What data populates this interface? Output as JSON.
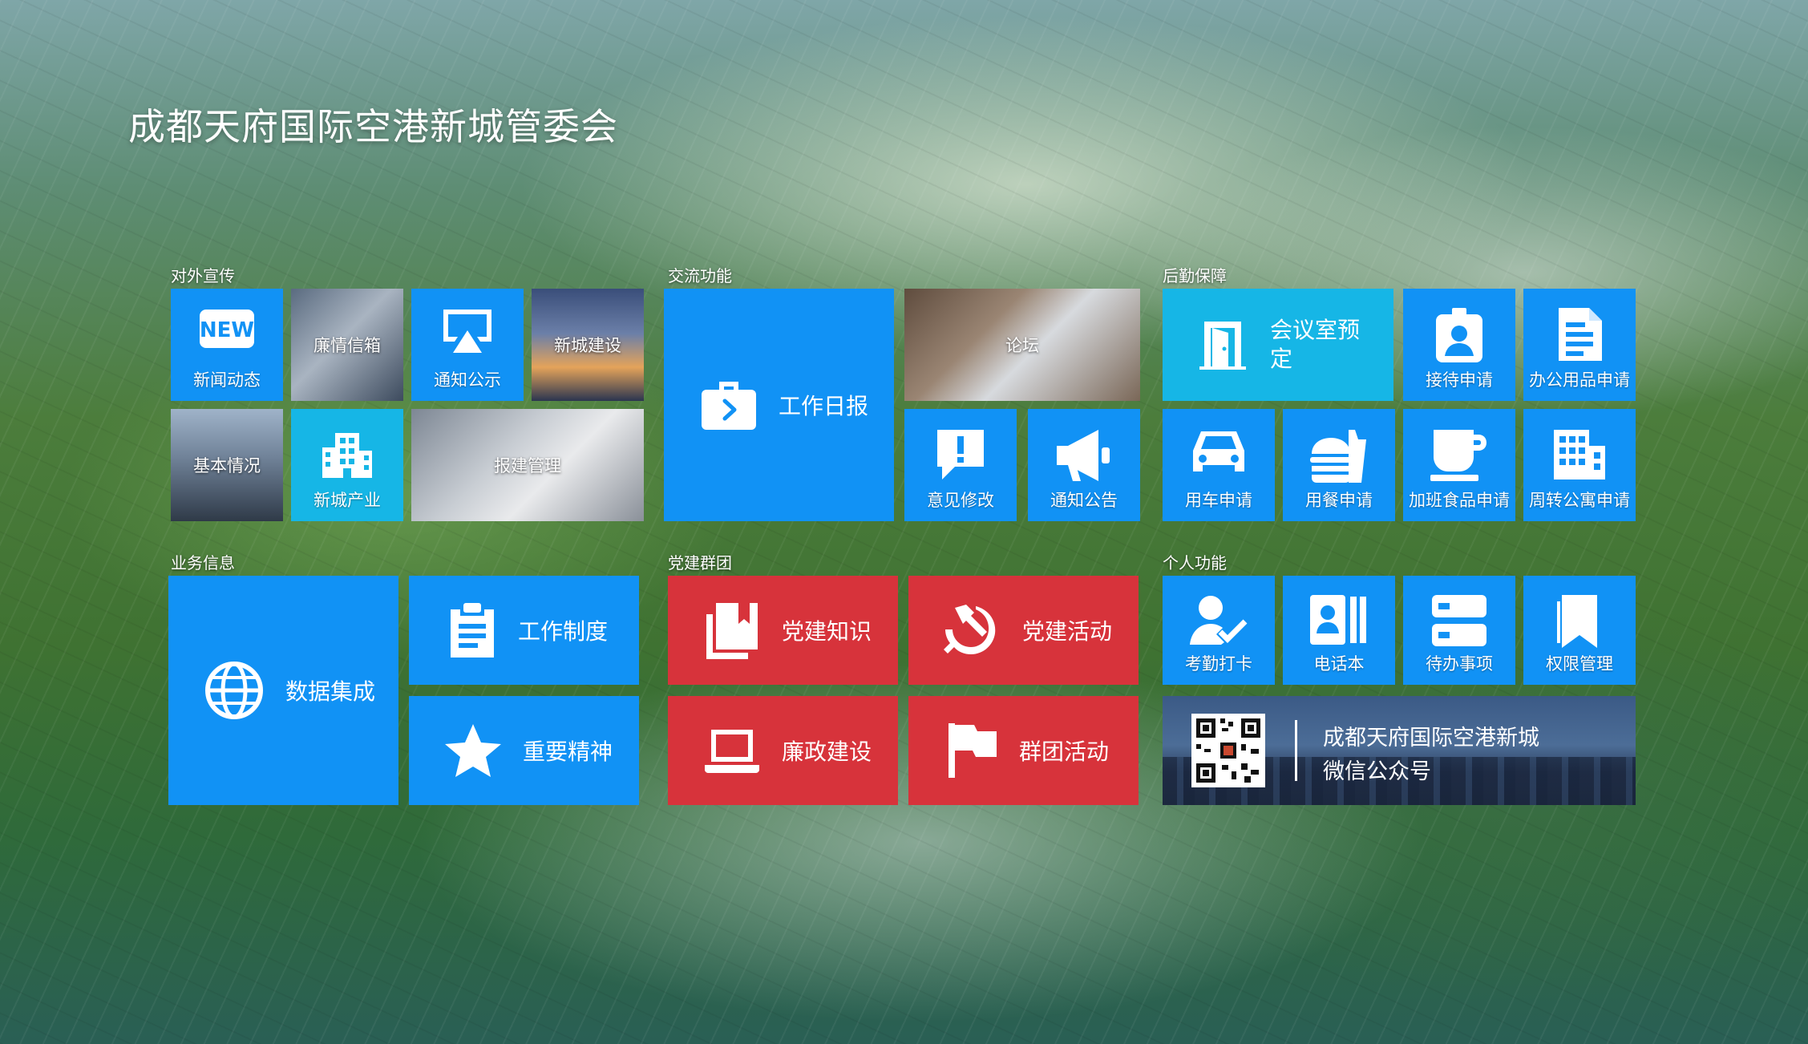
{
  "page": {
    "title": "成都天府国际空港新城管委会"
  },
  "sections": {
    "external": "对外宣传",
    "exchange": "交流功能",
    "logistics": "后勤保障",
    "business": "业务信息",
    "party": "党建群团",
    "personal": "个人功能"
  },
  "external_tiles": {
    "news": "新闻动态",
    "mailbox": "廉情信箱",
    "notice": "通知公示",
    "construction": "新城建设",
    "basic": "基本情况",
    "industry": "新城产业",
    "report_mgmt": "报建管理"
  },
  "exchange_tiles": {
    "daily_report": "工作日报",
    "forum": "论坛",
    "feedback": "意见修改",
    "announcement": "通知公告"
  },
  "logistics_tiles": {
    "meeting_room": "会议室预定",
    "reception": "接待申请",
    "office_supplies": "办公用品申请",
    "vehicle": "用车申请",
    "meal": "用餐申请",
    "overtime_food": "加班食品申请",
    "apartment": "周转公寓申请"
  },
  "business_tiles": {
    "data_integration": "数据集成",
    "work_system": "工作制度",
    "important_spirit": "重要精神"
  },
  "party_tiles": {
    "knowledge": "党建知识",
    "activity": "党建活动",
    "integrity": "廉政建设",
    "group_activity": "群团活动"
  },
  "personal_tiles": {
    "attendance": "考勤打卡",
    "phonebook": "电话本",
    "todo": "待办事项",
    "permission": "权限管理"
  },
  "wechat": {
    "line1": "成都天府国际空港新城",
    "line2": "微信公众号"
  },
  "colors": {
    "tile_blue": "#1192f5",
    "tile_red": "#d7333b",
    "tile_cyan": "#16b6e6"
  },
  "icons": {
    "news": "new-badge-icon",
    "notice": "airplay-icon",
    "industry": "building-icon",
    "daily_report": "briefcase-icon",
    "feedback": "exclamation-bubble-icon",
    "announcement": "megaphone-icon",
    "meeting_room": "door-icon",
    "reception": "badge-person-icon",
    "office_supplies": "document-icon",
    "vehicle": "car-icon",
    "meal": "burger-drink-icon",
    "overtime_food": "cup-icon",
    "apartment": "apartment-building-icon",
    "data_integration": "globe-icon",
    "work_system": "clipboard-icon",
    "important_spirit": "star-icon",
    "knowledge": "book-copy-icon",
    "activity": "hammer-sickle-icon",
    "integrity": "laptop-icon",
    "group_activity": "flag-icon",
    "attendance": "person-check-icon",
    "phonebook": "contact-card-icon",
    "todo": "server-list-icon",
    "permission": "bookmark-icon",
    "wechat": "qr-code-icon"
  }
}
